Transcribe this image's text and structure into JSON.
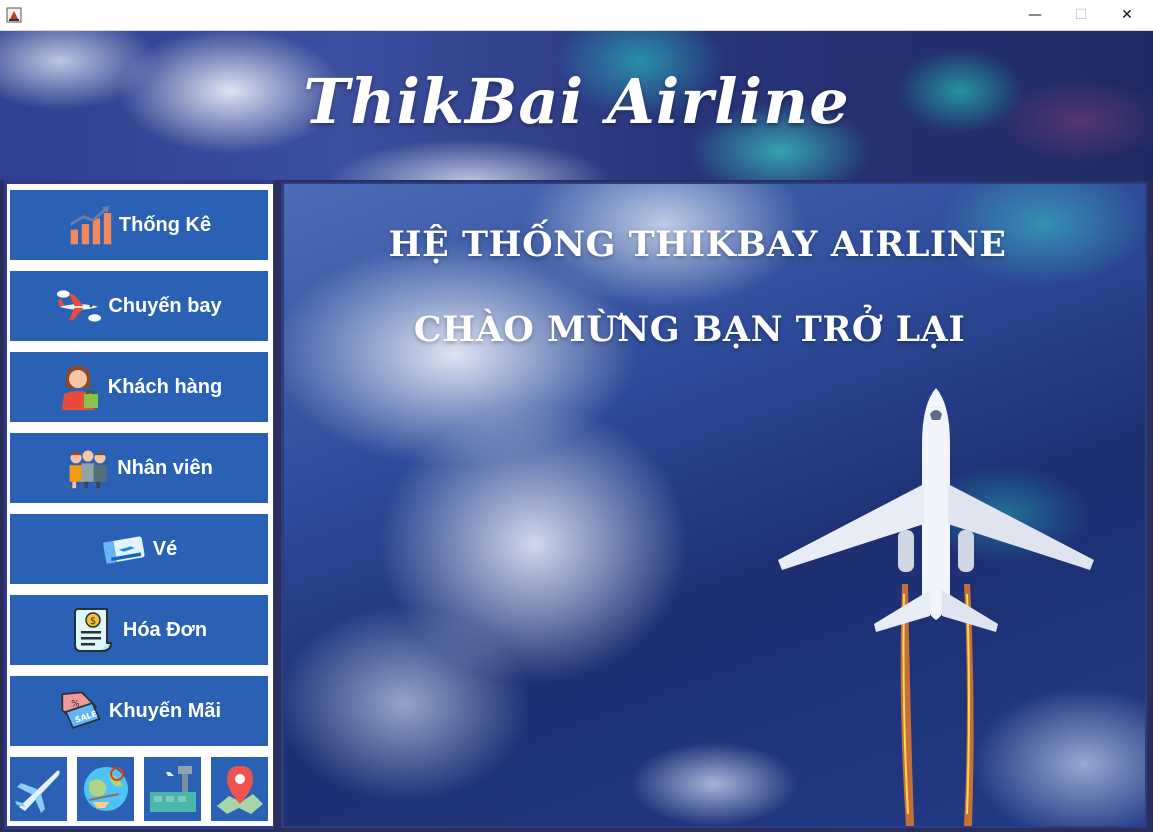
{
  "window": {
    "minimize_glyph": "—",
    "maximize_glyph": "☐",
    "close_glyph": "✕"
  },
  "banner": {
    "title": "ThikBai Airline"
  },
  "sidebar": {
    "items": [
      {
        "label": "Thống Kê",
        "icon": "bar-chart-growth-icon"
      },
      {
        "label": "Chuyến bay",
        "icon": "airplane-clouds-icon"
      },
      {
        "label": "Khách hàng",
        "icon": "customer-shopping-icon"
      },
      {
        "label": "Nhân viên",
        "icon": "staff-group-icon"
      },
      {
        "label": "Vé",
        "icon": "ticket-icon"
      },
      {
        "label": "Hóa Đơn",
        "icon": "invoice-icon"
      },
      {
        "label": "Khuyến Mãi",
        "icon": "sale-tag-icon"
      }
    ],
    "bottom_icons": [
      "airplane-icon",
      "travel-globe-icon",
      "airport-icon",
      "map-pin-icon"
    ]
  },
  "main": {
    "headline_1": "HỆ THỐNG THIKBAY AIRLINE",
    "headline_2": "CHÀO MỪNG BẠN TRỞ LẠI"
  },
  "colors": {
    "button_blue": "#2a61b5",
    "frame_blue": "#2c3b8a",
    "text_white": "#ffffff"
  }
}
